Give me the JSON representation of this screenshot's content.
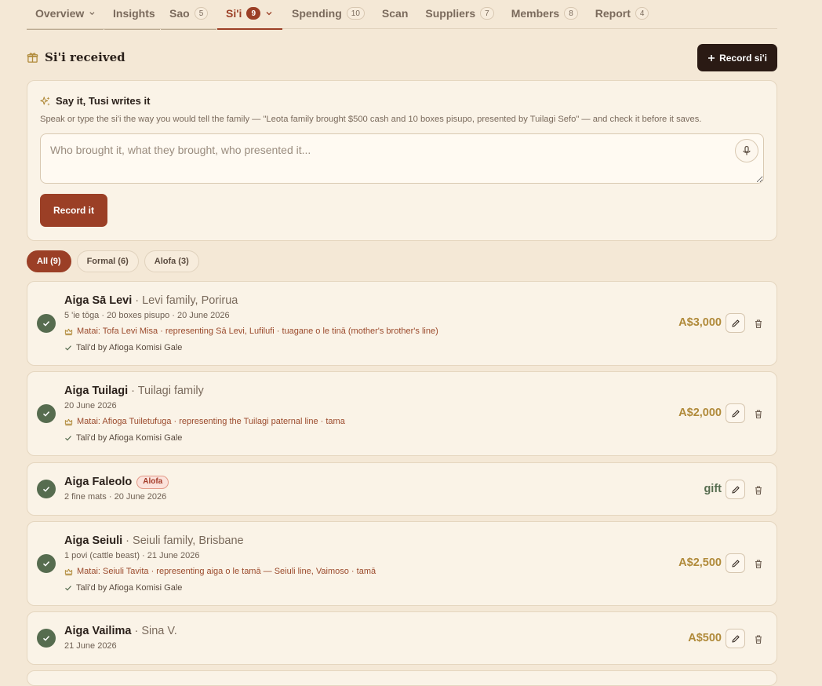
{
  "tabs": [
    {
      "label": "Overview",
      "has_chevron": true
    },
    {
      "label": "Insights"
    },
    {
      "label": "Sao",
      "count": "5"
    },
    {
      "label": "Si'i",
      "count": "9",
      "has_chevron": true
    },
    {
      "label": "Spending",
      "count": "10"
    },
    {
      "label": "Scan"
    },
    {
      "label": "Suppliers",
      "count": "7"
    },
    {
      "label": "Members",
      "count": "8"
    },
    {
      "label": "Report",
      "count": "4"
    }
  ],
  "section": {
    "title": "Si'i received",
    "record_button": "Record si'i"
  },
  "say_it": {
    "title": "Say it, Tusi writes it",
    "description": "Speak or type the si'i the way you would tell the family — \"Leota family brought $500 cash and 10 boxes pisupo, presented by Tuilagi Sefo\" — and check it before it saves.",
    "placeholder": "Who brought it, what they brought, who presented it...",
    "value": "",
    "submit": "Record it"
  },
  "filters": [
    {
      "label": "All (9)",
      "active": true
    },
    {
      "label": "Formal (6)"
    },
    {
      "label": "Alofa (3)"
    }
  ],
  "entries": [
    {
      "name": "Aiga Sā Levi",
      "sub": "· Levi family, Porirua",
      "meta": "5 'ie tōga · 20 boxes pisupo · 20 June 2026",
      "matai": "Matai: Tofa Levi Misa · representing Sā Levi, Lufilufi · tuagane o le tinā (mother's brother's line)",
      "tali": "Tali'd by Afioga Komisi Gale",
      "amount": "A$3,000"
    },
    {
      "name": "Aiga Tuilagi",
      "sub": "· Tuilagi family",
      "meta": "20 June 2026",
      "matai": "Matai: Afioga Tuiletufuga · representing the Tuilagi paternal line · tama",
      "tali": "Tali'd by Afioga Komisi Gale",
      "amount": "A$2,000"
    },
    {
      "name": "Aiga Faleolo",
      "tag": "Alofa",
      "meta": "2 fine mats · 20 June 2026",
      "amount": "gift"
    },
    {
      "name": "Aiga Seiuli",
      "sub": "· Seiuli family, Brisbane",
      "meta": "1 povi (cattle beast) · 21 June 2026",
      "matai": "Matai: Seiuli Tavita · representing aiga o le tamā — Seiuli line, Vaimoso · tamā",
      "tali": "Tali'd by Afioga Komisi Gale",
      "amount": "A$2,500"
    },
    {
      "name": "Aiga Vailima",
      "sub": "· Sina V.",
      "meta": "21 June 2026",
      "amount": "A$500"
    }
  ],
  "colors": {
    "accent": "#9b3f26",
    "dark_button": "#2a1a14",
    "check": "#566c4f",
    "amount": "#b08a3a",
    "background": "#f4e8d6"
  }
}
